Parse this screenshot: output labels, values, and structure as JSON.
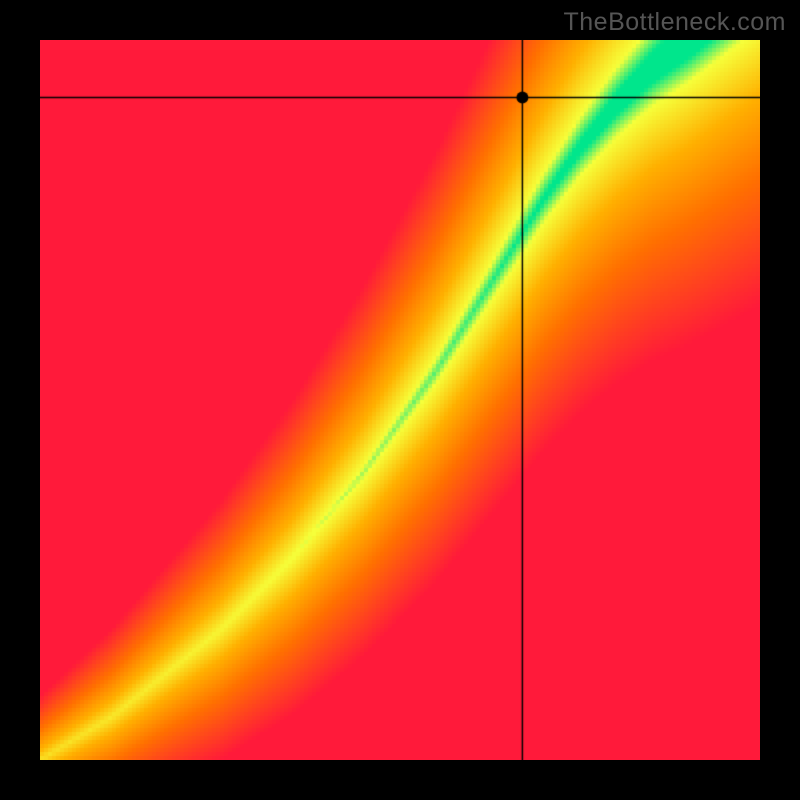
{
  "watermark": "TheBottleneck.com",
  "chart_data": {
    "type": "heatmap",
    "title": "",
    "xlabel": "",
    "ylabel": "",
    "x_range": [
      0,
      1
    ],
    "y_range": [
      0,
      1
    ],
    "crosshair": {
      "x": 0.67,
      "y": 0.92
    },
    "marker": {
      "x": 0.67,
      "y": 0.92
    },
    "ridge_curve_points": [
      {
        "x": 0.0,
        "y": 0.0
      },
      {
        "x": 0.05,
        "y": 0.03
      },
      {
        "x": 0.1,
        "y": 0.06
      },
      {
        "x": 0.15,
        "y": 0.1
      },
      {
        "x": 0.2,
        "y": 0.14
      },
      {
        "x": 0.25,
        "y": 0.18
      },
      {
        "x": 0.3,
        "y": 0.23
      },
      {
        "x": 0.35,
        "y": 0.28
      },
      {
        "x": 0.4,
        "y": 0.34
      },
      {
        "x": 0.45,
        "y": 0.4
      },
      {
        "x": 0.5,
        "y": 0.47
      },
      {
        "x": 0.55,
        "y": 0.54
      },
      {
        "x": 0.6,
        "y": 0.62
      },
      {
        "x": 0.65,
        "y": 0.7
      },
      {
        "x": 0.7,
        "y": 0.78
      },
      {
        "x": 0.75,
        "y": 0.85
      },
      {
        "x": 0.8,
        "y": 0.91
      },
      {
        "x": 0.85,
        "y": 0.96
      },
      {
        "x": 0.9,
        "y": 1.0
      },
      {
        "x": 1.0,
        "y": 1.08
      }
    ],
    "color_stops": {
      "ridge": "#00e68c",
      "near": "#f6ff3a",
      "mid": "#ffb000",
      "far": "#ff7000",
      "edge": "#ff1a3a"
    },
    "grid_resolution": 180
  }
}
